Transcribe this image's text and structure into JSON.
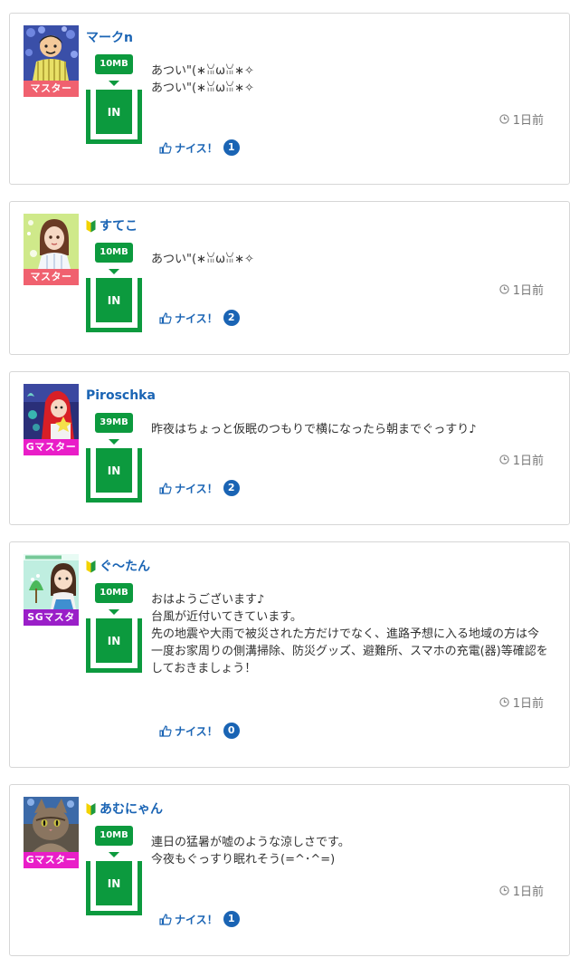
{
  "colors": {
    "brand_green": "#0c9a3e",
    "link_blue": "#1a64b4",
    "rank_master": "#f0616f",
    "rank_gmaster": "#e91ec8",
    "rank_sgmaster": "#9a1fc8"
  },
  "posts": [
    {
      "username": "マークn",
      "beginner": false,
      "rank": "マスター",
      "rank_color": "#f0616f",
      "avatar": "avatar-man-flowers",
      "data_amount": "10MB",
      "data_label": "IN",
      "message": "あつい\"(∗ꈍωꈍ∗✧\nあつい\"(∗ꈍωꈍ∗✧",
      "time": "1日前",
      "nice_label": "ナイス！",
      "nice_count": "1"
    },
    {
      "username": "すてこ",
      "beginner": true,
      "rank": "マスター",
      "rank_color": "#f0616f",
      "avatar": "avatar-girl-green",
      "data_amount": "10MB",
      "data_label": "IN",
      "message": "あつい\"(∗ꈍωꈍ∗✧",
      "time": "1日前",
      "nice_label": "ナイス！",
      "nice_count": "2"
    },
    {
      "username": "Piroschka",
      "beginner": false,
      "rank": "Gマスター",
      "rank_color": "#e91ec8",
      "avatar": "avatar-red-hood",
      "data_amount": "39MB",
      "data_label": "IN",
      "message": "昨夜はちょっと仮眠のつもりで横になったら朝までぐっすり♪",
      "time": "1日前",
      "nice_label": "ナイス！",
      "nice_count": "2"
    },
    {
      "username": "ぐ〜たん",
      "beginner": true,
      "rank": "SGマスタ",
      "rank_color": "#9a1fc8",
      "avatar": "avatar-mineo-green",
      "data_amount": "10MB",
      "data_label": "IN",
      "message": "おはようございます♪\n台風が近付いてきています。\n先の地震や大雨で被災された方だけでなく、進路予想に入る地域の方は今一度お家周りの側溝掃除、防災グッズ、避難所、スマホの充電(器)等確認をしておきましょう！",
      "time": "1日前",
      "nice_label": "ナイス！",
      "nice_count": "0"
    },
    {
      "username": "あむにゃん",
      "beginner": true,
      "rank": "Gマスター",
      "rank_color": "#e91ec8",
      "avatar": "avatar-cat",
      "data_amount": "10MB",
      "data_label": "IN",
      "message": "連日の猛暑が嘘のような涼しさです。\n今夜もぐっすり眠れそう(=^･^=)",
      "time": "1日前",
      "nice_label": "ナイス！",
      "nice_count": "1"
    }
  ]
}
